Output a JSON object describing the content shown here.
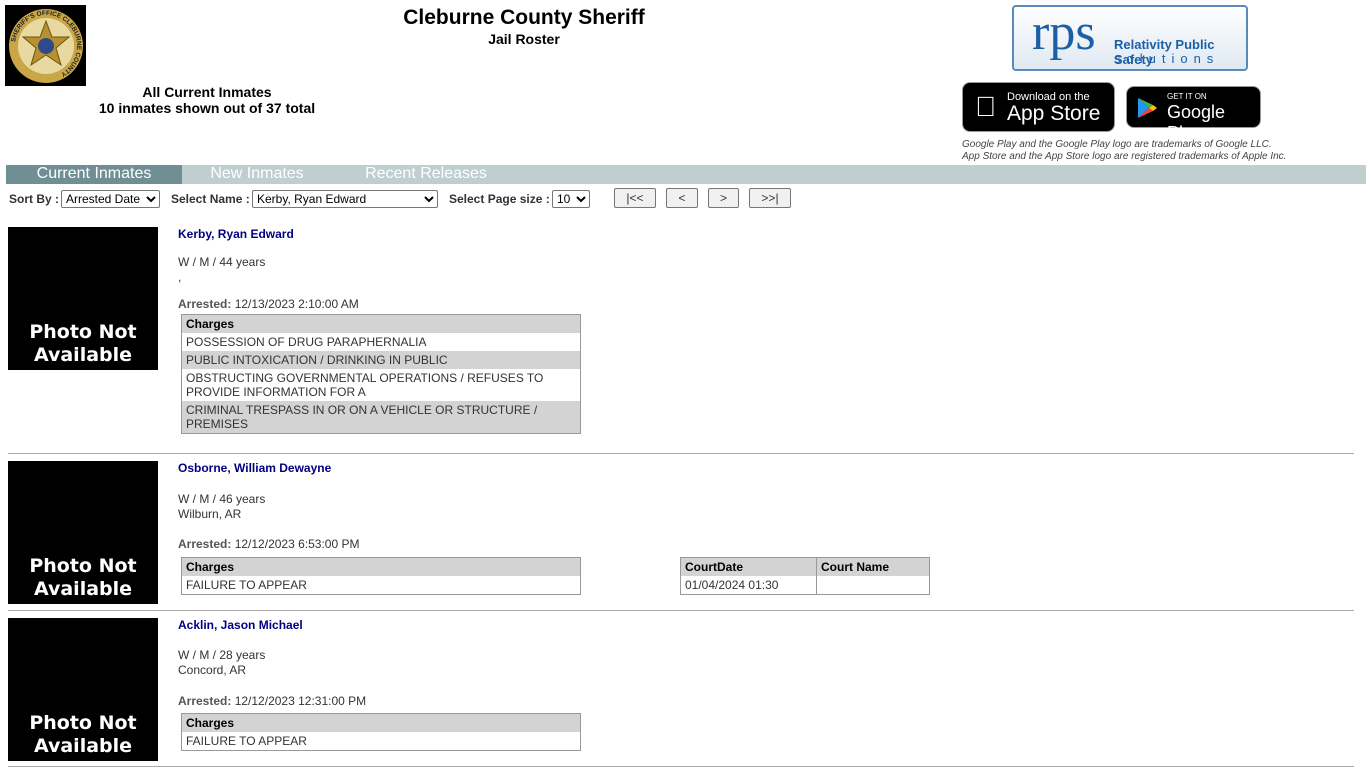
{
  "header": {
    "badge_text": "SHERIFF'S OFFICE CLEBURNE COUNTY",
    "title": "Cleburne County Sheriff",
    "subtitle": "Jail Roster",
    "summary_line1": "All Current Inmates",
    "summary_line2": "10 inmates shown out of 37 total"
  },
  "vendor": {
    "logo_big": "rps",
    "logo_line1": "Relativity Public Safety",
    "logo_line2": "solutions"
  },
  "stores": {
    "apple_small": "Download on the",
    "apple_big": "App Store",
    "google_small": "GET IT ON",
    "google_big": "Google Play",
    "legal1": "Google Play and the Google Play logo are trademarks of Google LLC.",
    "legal2": "App Store and the App Store logo are registered trademarks of Apple Inc."
  },
  "tabs": [
    {
      "label": "Current Inmates",
      "active": true
    },
    {
      "label": "New Inmates"
    },
    {
      "label": "Recent Releases"
    }
  ],
  "controls": {
    "sort_label": "Sort By :",
    "sort_value": "Arrested Date",
    "name_label": "Select Name :",
    "name_value": "Kerby, Ryan Edward",
    "size_label": "Select Page size :",
    "size_value": "10",
    "first": "|<<",
    "prev": "<",
    "next": ">",
    "last": ">>|"
  },
  "photo_text": "Photo Not Available",
  "arrested_label": "Arrested:",
  "charges_header": "Charges",
  "court_headers": [
    "CourtDate",
    "Court Name"
  ],
  "inmates": [
    {
      "name": "Kerby, Ryan Edward",
      "demo": "W / M / 44 years",
      "location": ",",
      "arrested": "12/13/2023 2:10:00 AM",
      "charges": [
        "POSSESSION OF DRUG PARAPHERNALIA",
        "PUBLIC INTOXICATION / DRINKING IN PUBLIC",
        "OBSTRUCTING GOVERNMENTAL OPERATIONS / REFUSES TO PROVIDE INFORMATION FOR A",
        "CRIMINAL TRESPASS IN OR ON A VEHICLE OR STRUCTURE / PREMISES"
      ]
    },
    {
      "name": "Osborne, William Dewayne",
      "demo": "W / M / 46 years",
      "location": "Wilburn, AR",
      "arrested": "12/12/2023 6:53:00 PM",
      "charges": [
        "FAILURE TO APPEAR"
      ],
      "court": {
        "date": "01/04/2024 01:30",
        "name": ""
      }
    },
    {
      "name": "Acklin, Jason Michael",
      "demo": "W / M / 28 years",
      "location": "Concord, AR",
      "arrested": "12/12/2023 12:31:00 PM",
      "charges": [
        "FAILURE TO APPEAR"
      ]
    }
  ]
}
